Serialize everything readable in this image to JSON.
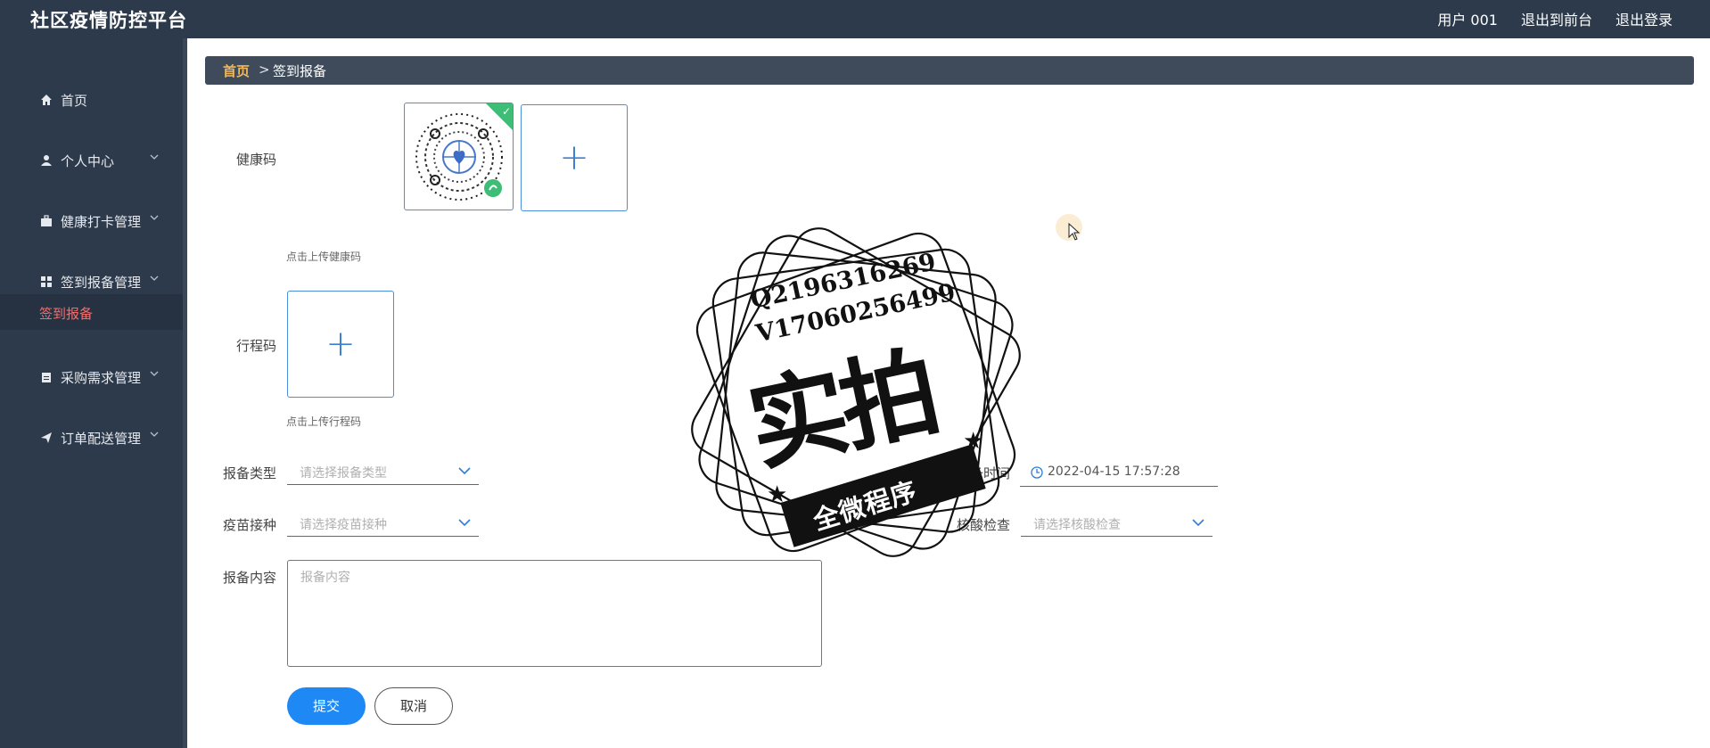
{
  "app": {
    "title": "社区疫情防控平台"
  },
  "topbar": {
    "user": "用户 001",
    "front": "退出到前台",
    "logout": "退出登录"
  },
  "sidebar": {
    "items": [
      {
        "label": "首页",
        "icon": "home-icon"
      },
      {
        "label": "个人中心",
        "icon": "user-icon"
      },
      {
        "label": "健康打卡管理",
        "icon": "briefcase-icon"
      },
      {
        "label": "签到报备管理",
        "icon": "grid-icon"
      },
      {
        "label": "签到报备",
        "icon": ""
      },
      {
        "label": "采购需求管理",
        "icon": "clipboard-icon"
      },
      {
        "label": "订单配送管理",
        "icon": "send-icon"
      }
    ]
  },
  "breadcrumb": {
    "home": "首页",
    "separator": ">",
    "current": "签到报备"
  },
  "form": {
    "health_code_label": "健康码",
    "health_code_hint": "点击上传健康码",
    "trip_code_label": "行程码",
    "trip_code_hint": "点击上传行程码",
    "report_type_label": "报备类型",
    "report_type_placeholder": "请选择报备类型",
    "report_time_label": "报备时间",
    "report_time_value": "2022-04-15 17:57:28",
    "vaccine_label": "疫苗接种",
    "vaccine_placeholder": "请选择疫苗接种",
    "nucleic_label": "核酸检查",
    "nucleic_placeholder": "请选择核酸检查",
    "content_label": "报备内容",
    "content_placeholder": "报备内容",
    "submit": "提交",
    "cancel": "取消"
  },
  "stamp": {
    "line1": "Q2196316269",
    "line2": "V17060256499",
    "big": "实拍",
    "banner": "全微程序"
  },
  "colors": {
    "topbar": "#2d3a4b",
    "accent": "#1e88f5",
    "active_menu": "#f56c6c",
    "breadcrumb_home": "#f0b85b"
  }
}
